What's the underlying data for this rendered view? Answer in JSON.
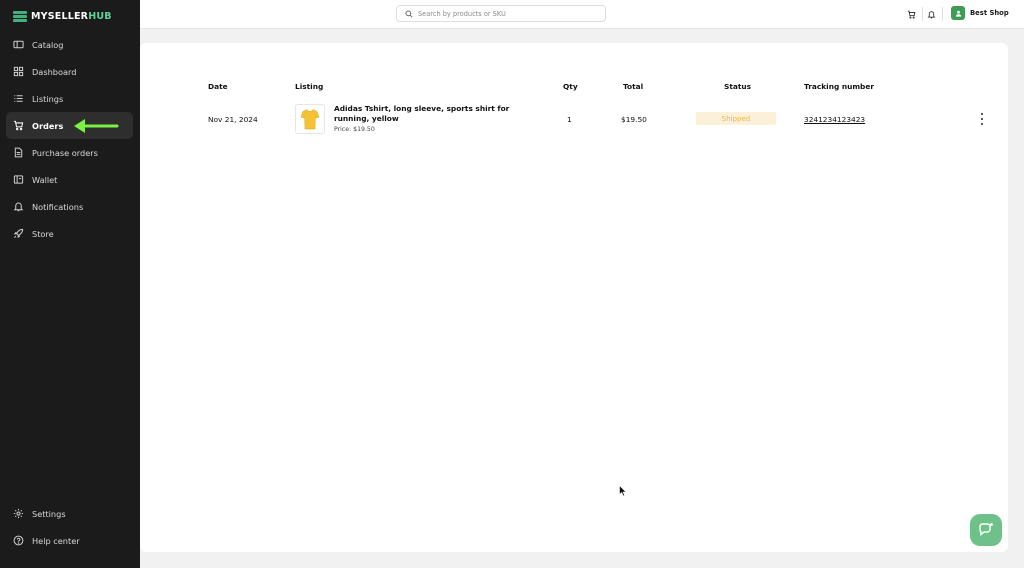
{
  "brand": {
    "part1": "MYSELLER",
    "part2": "HUB"
  },
  "colors": {
    "sidebar_bg": "#1b1b1b",
    "brand_green": "#3fb27f",
    "arrow_green": "#7cf043",
    "status_bg": "#fdf0d8",
    "status_text": "#f0b54c",
    "chat_bg": "#6fc18a"
  },
  "sidebar": {
    "items": [
      {
        "label": "Catalog",
        "icon": "catalog-icon"
      },
      {
        "label": "Dashboard",
        "icon": "dashboard-icon"
      },
      {
        "label": "Listings",
        "icon": "list-icon"
      },
      {
        "label": "Orders",
        "icon": "cart-icon",
        "active": true
      },
      {
        "label": "Purchase orders",
        "icon": "document-icon"
      },
      {
        "label": "Wallet",
        "icon": "wallet-icon"
      },
      {
        "label": "Notifications",
        "icon": "bell-icon"
      },
      {
        "label": "Store",
        "icon": "rocket-icon"
      }
    ],
    "bottom": [
      {
        "label": "Settings",
        "icon": "gear-icon"
      },
      {
        "label": "Help center",
        "icon": "help-icon"
      }
    ]
  },
  "search": {
    "placeholder": "Search by products or SKU"
  },
  "header": {
    "shop_name": "Best Shop"
  },
  "table": {
    "columns": {
      "date": "Date",
      "listing": "Listing",
      "qty": "Qty",
      "total": "Total",
      "status": "Status",
      "tracking": "Tracking number"
    },
    "rows": [
      {
        "date": "Nov 21, 2024",
        "product": "Adidas Tshirt, long sleeve, sports shirt for running, yellow",
        "price": "Price: $19.50",
        "qty": "1",
        "total": "$19.50",
        "status": "Shipped",
        "tracking": "3241234123423"
      }
    ]
  }
}
